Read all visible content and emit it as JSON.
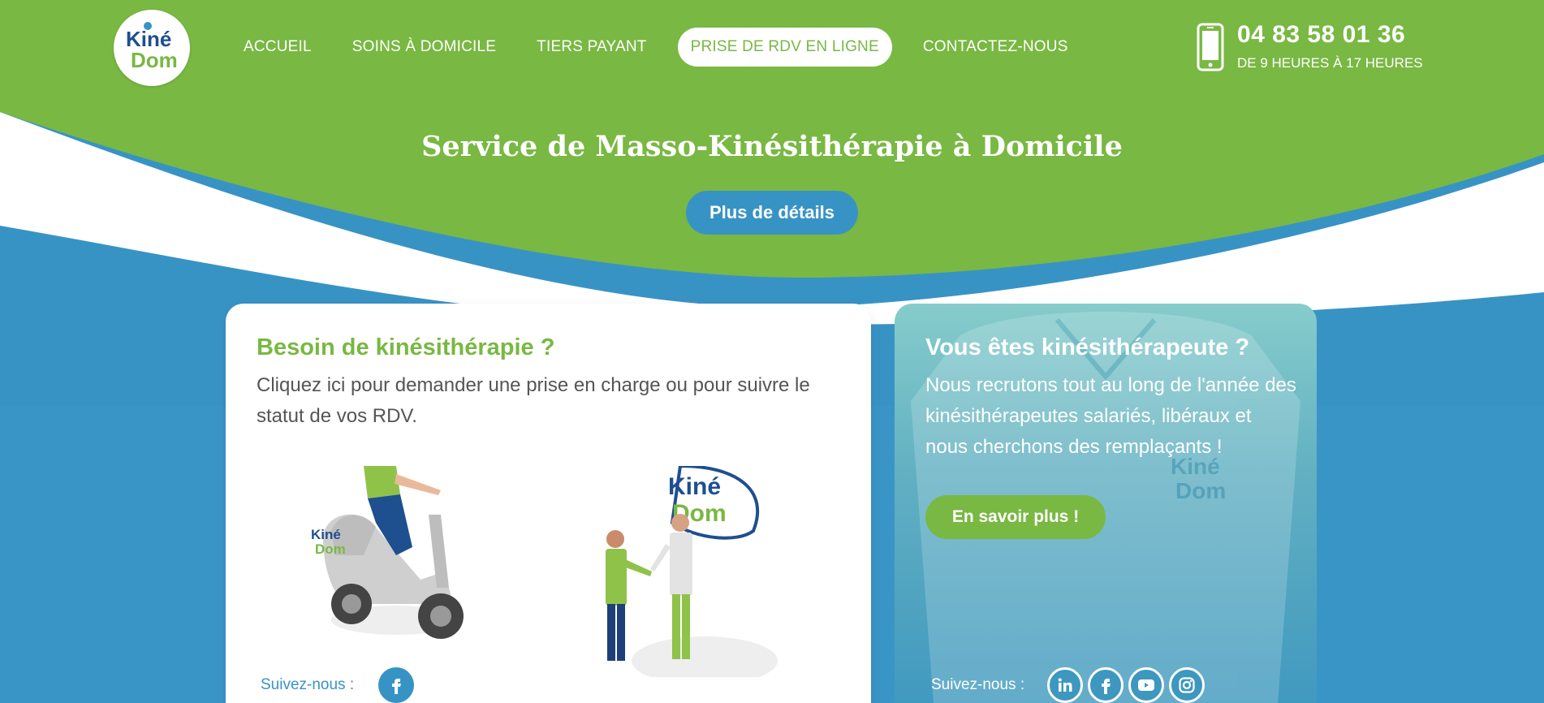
{
  "brand": {
    "logo_top": "Kiné",
    "logo_bottom": "Dom",
    "green": "#79b843",
    "blue": "#3893c5"
  },
  "nav": {
    "items": [
      {
        "label": "ACCUEIL"
      },
      {
        "label": "SOINS À DOMICILE"
      },
      {
        "label": "TIERS PAYANT"
      },
      {
        "label": "PRISE DE RDV EN LIGNE",
        "active": true
      },
      {
        "label": "CONTACTEZ-NOUS"
      }
    ]
  },
  "contact": {
    "phone": "04 83 58 01 36",
    "hours": "DE 9 HEURES À 17 HEURES",
    "icon": "smartphone-icon"
  },
  "hero": {
    "title": "Service de Masso-Kinésithérapie à Domicile",
    "button": "Plus de détails"
  },
  "patient_card": {
    "title": "Besoin de kinésithérapie ?",
    "text": "Cliquez ici pour demander une prise en charge ou pour suivre le statut de vos RDV.",
    "follow_label": "Suivez-nous :",
    "socials": [
      "facebook-icon"
    ]
  },
  "recruit_card": {
    "title": "Vous êtes kinésithérapeute ?",
    "text": "Nous recrutons tout au long de l'année des kinésithérapeutes salariés, libéraux et nous cherchons des remplaçants !",
    "button": "En savoir plus !",
    "follow_label": "Suivez-nous :",
    "socials": [
      "linkedin-icon",
      "facebook-icon",
      "youtube-icon",
      "instagram-icon"
    ]
  }
}
